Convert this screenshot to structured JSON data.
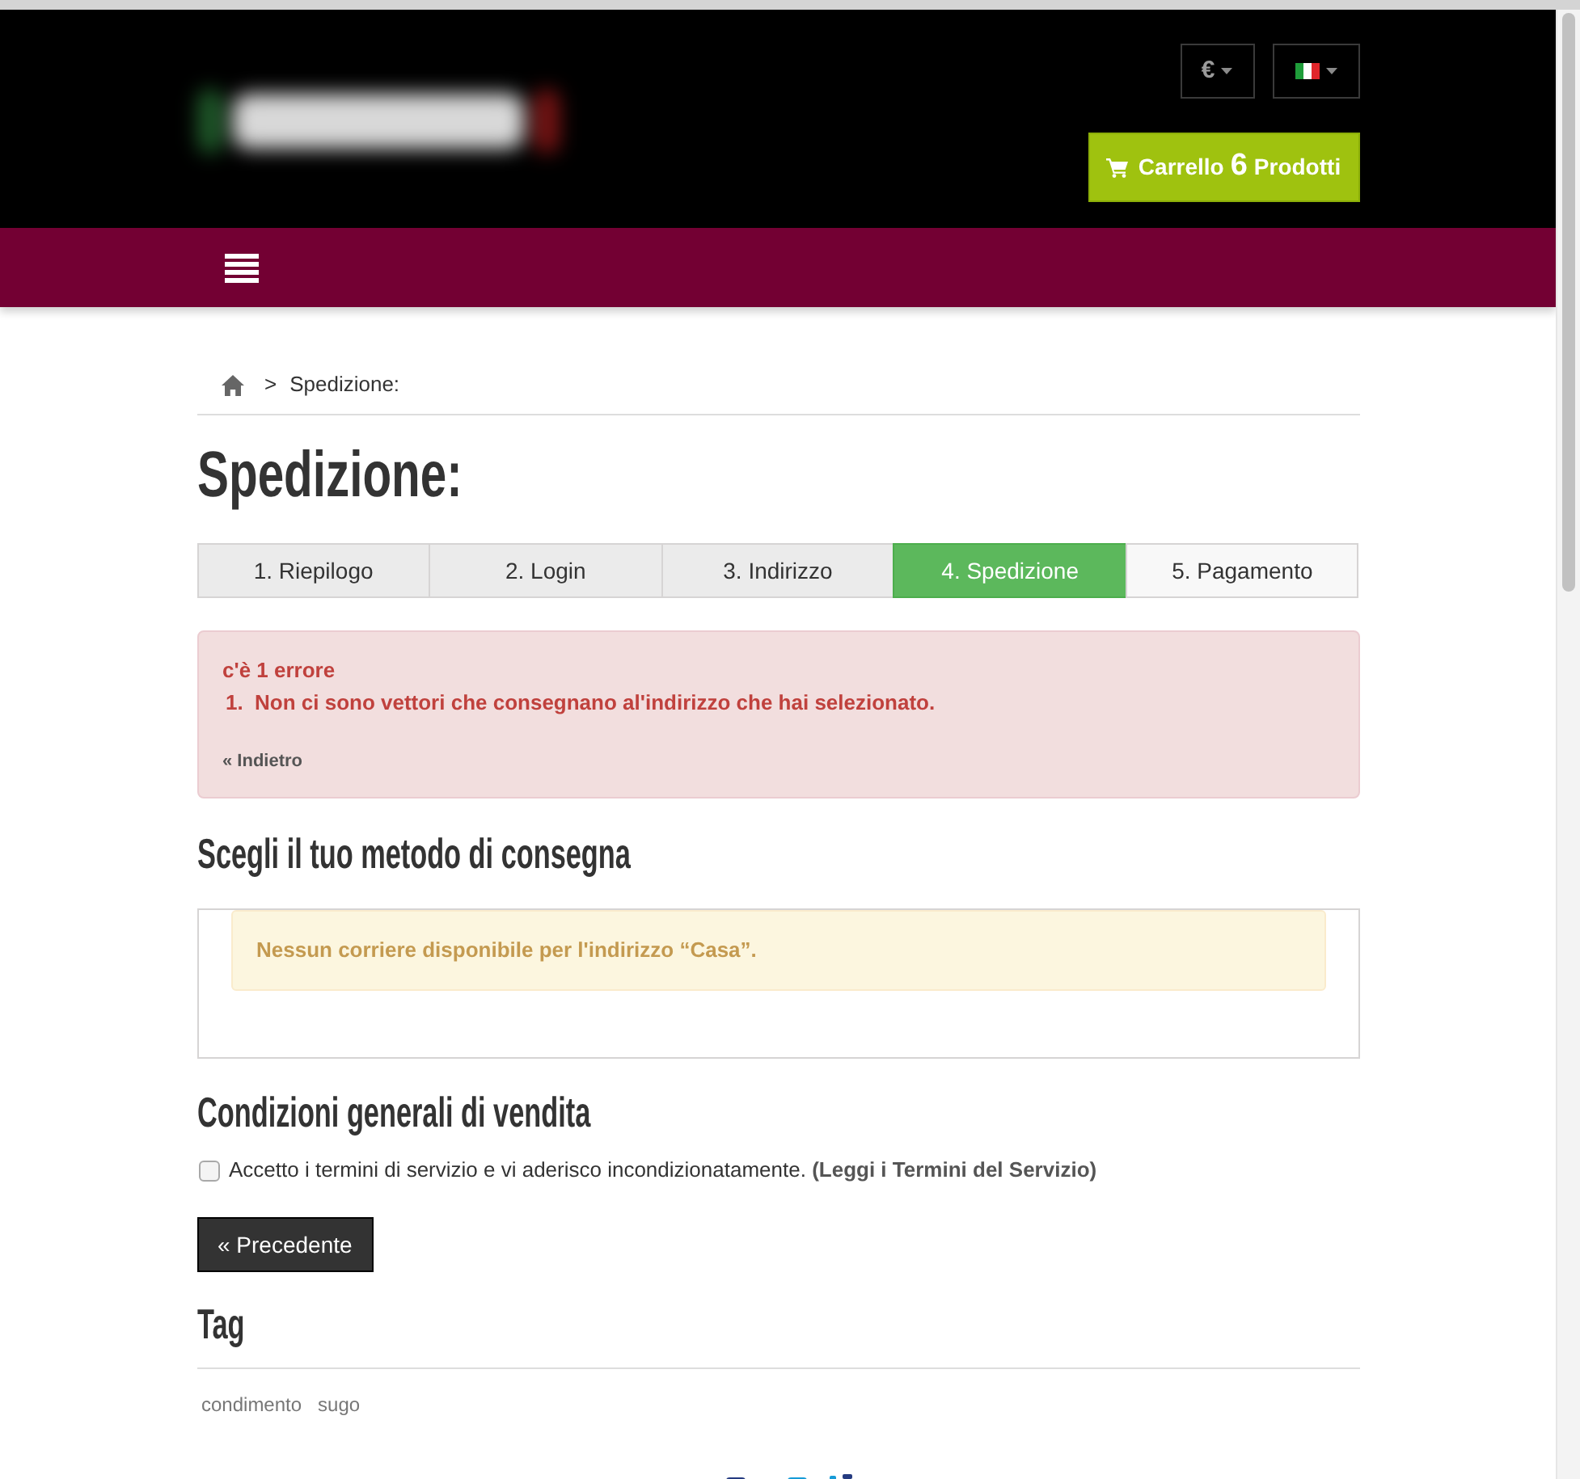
{
  "header": {
    "currency": "€",
    "cart": {
      "label": "Carrello",
      "count": "6",
      "unit": "Prodotti"
    }
  },
  "breadcrumb": {
    "separator": ">",
    "current": "Spedizione:"
  },
  "title": "Spedizione:",
  "steps": [
    {
      "label": "1. Riepilogo",
      "selected": false
    },
    {
      "label": "2. Login",
      "selected": false
    },
    {
      "label": "3. Indirizzo",
      "selected": false
    },
    {
      "label": "4. Spedizione",
      "selected": true
    },
    {
      "label": "5. Pagamento",
      "selected": false
    }
  ],
  "error": {
    "title": "c'è 1 errore",
    "items": [
      {
        "number": "1.",
        "text": "Non ci sono vettori che consegnano al'indirizzo che hai selezionato."
      }
    ],
    "back_link": "« Indietro"
  },
  "delivery": {
    "heading": "Scegli il tuo metodo di consegna",
    "warning": "Nessun corriere disponibile per l'indirizzo “Casa”."
  },
  "terms": {
    "heading": "Condizioni generali di vendita",
    "checked": false,
    "label": "Accetto i termini di servizio e vi aderisco incondizionatamente.",
    "link": "(Leggi i Termini del Servizio)"
  },
  "previous_button": "« Precedente",
  "tags": {
    "heading": "Tag",
    "items": [
      "condimento",
      "sugo"
    ]
  }
}
